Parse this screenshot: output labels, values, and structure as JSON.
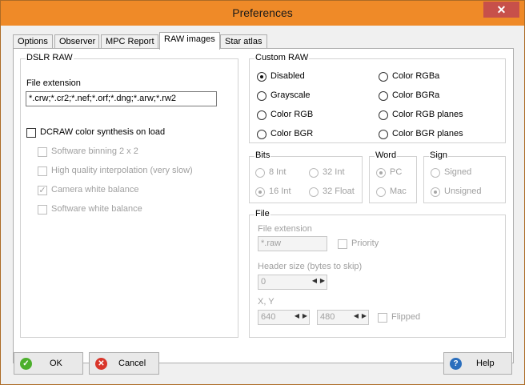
{
  "window": {
    "title": "Preferences",
    "close_glyph": "✕"
  },
  "tabs": [
    "Options",
    "Observer",
    "MPC Report",
    "RAW images",
    "Star atlas"
  ],
  "dslr": {
    "group_title": "DSLR RAW",
    "file_ext_label": "File extension",
    "file_ext_value": "*.crw;*.cr2;*.nef;*.orf;*.dng;*.arw;*.rw2",
    "dcraw_label": "DCRAW color synthesis on load",
    "options": [
      {
        "label": "Software binning 2 x 2",
        "checked": false
      },
      {
        "label": "High quality interpolation (very slow)",
        "checked": false
      },
      {
        "label": "Camera white balance",
        "checked": true
      },
      {
        "label": "Software white balance",
        "checked": false
      }
    ]
  },
  "custom_raw": {
    "group_title": "Custom RAW",
    "left": [
      "Disabled",
      "Grayscale",
      "Color RGB",
      "Color BGR"
    ],
    "right": [
      "Color RGBa",
      "Color BGRa",
      "Color RGB planes",
      "Color BGR planes"
    ],
    "selected": "Disabled"
  },
  "bits": {
    "group_title": "Bits",
    "options": [
      "8  Int",
      "32 Int",
      "16 Int",
      "32 Float"
    ],
    "selected": "16 Int"
  },
  "word": {
    "group_title": "Word",
    "options": [
      "PC",
      "Mac"
    ],
    "selected": "PC"
  },
  "sign": {
    "group_title": "Sign",
    "options": [
      "Signed",
      "Unsigned"
    ],
    "selected": "Unsigned"
  },
  "file": {
    "group_title": "File",
    "ext_label": "File extension",
    "ext_value": "*.raw",
    "priority_label": "Priority",
    "header_label": "Header size (bytes to skip)",
    "header_value": "0",
    "xy_label": "X, Y",
    "x_value": "640",
    "y_value": "480",
    "flipped_label": "Flipped"
  },
  "buttons": {
    "ok": "OK",
    "cancel": "Cancel",
    "help": "Help"
  },
  "colors": {
    "titlebar": "#ef8a28",
    "ok_icon": "#4caf2c",
    "cancel_icon": "#d9362b",
    "help_icon": "#2a6ebd"
  }
}
